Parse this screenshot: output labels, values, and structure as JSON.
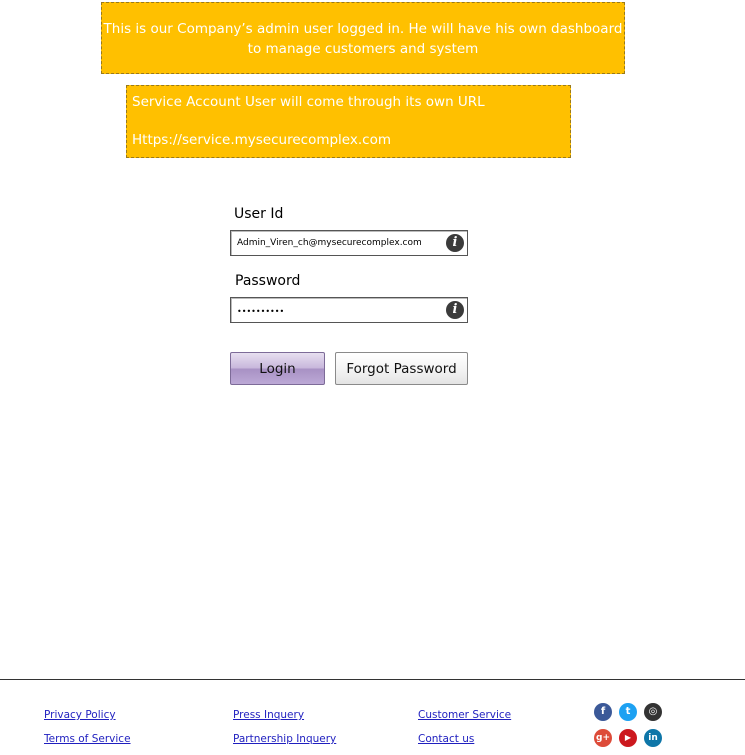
{
  "notes": {
    "admin_note": "This is our Company’s admin user logged in. He will have his own dashboard to manage customers and system",
    "service_note_line1": "Service Account User will come through its own URL",
    "service_note_line2": "Https://service.mysecurecomplex.com"
  },
  "login": {
    "user_id_label": "User Id",
    "user_id_value": "Admin_Viren_ch@mysecurecomplex.com",
    "password_label": "Password",
    "password_value": "••••••••••",
    "info_glyph": "i",
    "login_button": "Login",
    "forgot_button": "Forgot Password"
  },
  "footer": {
    "col1": [
      "Privacy Policy",
      "Terms of Service"
    ],
    "col2": [
      "Press Inquery",
      "Partnership Inquery"
    ],
    "col3": [
      "Customer Service",
      "Contact us"
    ]
  },
  "social": {
    "facebook": {
      "glyph": "f",
      "color": "#3b5998"
    },
    "twitter": {
      "glyph": "t",
      "color": "#1da1f2"
    },
    "instagram": {
      "glyph": "◎",
      "color": "#333333"
    },
    "google_plus": {
      "glyph": "g+",
      "color": "#dd4b39"
    },
    "youtube": {
      "glyph": "▶",
      "color": "#cc181e"
    },
    "linkedin": {
      "glyph": "in",
      "color": "#0e76a8"
    }
  },
  "colors": {
    "note_background": "#ffc000",
    "login_button": "#c8b7dc",
    "link": "#1f1fbf"
  }
}
